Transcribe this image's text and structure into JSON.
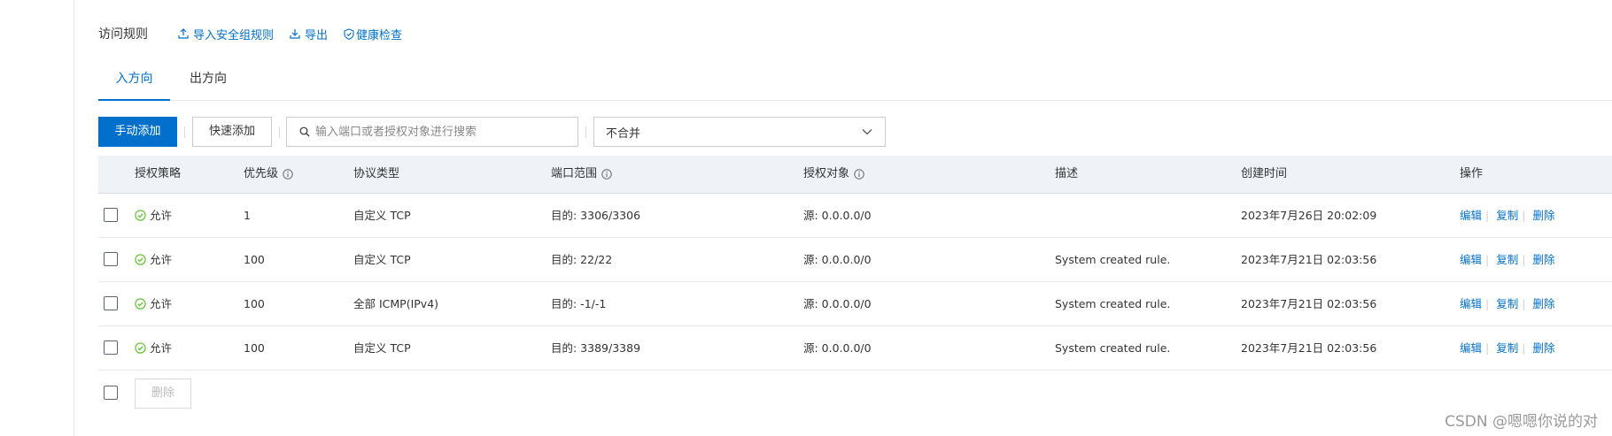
{
  "header": {
    "title": "访问规则",
    "import_label": "导入安全组规则",
    "export_label": "导出",
    "health_label": "健康检查"
  },
  "tabs": [
    {
      "label": "入方向",
      "active": true
    },
    {
      "label": "出方向",
      "active": false
    }
  ],
  "toolbar": {
    "manual_add": "手动添加",
    "quick_add": "快速添加",
    "search_placeholder": "输入端口或者授权对象进行搜索",
    "merge_select_value": "不合并"
  },
  "table": {
    "columns": [
      "授权策略",
      "优先级",
      "协议类型",
      "端口范围",
      "授权对象",
      "描述",
      "创建时间",
      "操作"
    ],
    "rows": [
      {
        "policy": "允许",
        "priority": "1",
        "protocol": "自定义 TCP",
        "port": "目的: 3306/3306",
        "target": "源: 0.0.0.0/0",
        "desc": "",
        "created": "2023年7月26日 20:02:09"
      },
      {
        "policy": "允许",
        "priority": "100",
        "protocol": "自定义 TCP",
        "port": "目的: 22/22",
        "target": "源: 0.0.0.0/0",
        "desc": "System created rule.",
        "created": "2023年7月21日 02:03:56"
      },
      {
        "policy": "允许",
        "priority": "100",
        "protocol": "全部 ICMP(IPv4)",
        "port": "目的: -1/-1",
        "target": "源: 0.0.0.0/0",
        "desc": "System created rule.",
        "created": "2023年7月21日 02:03:56"
      },
      {
        "policy": "允许",
        "priority": "100",
        "protocol": "自定义 TCP",
        "port": "目的: 3389/3389",
        "target": "源: 0.0.0.0/0",
        "desc": "System created rule.",
        "created": "2023年7月21日 02:03:56"
      }
    ],
    "ops": {
      "edit": "编辑",
      "copy": "复制",
      "delete": "删除"
    },
    "footer_delete": "删除"
  },
  "watermark": "CSDN @嗯嗯你说的对",
  "colors": {
    "primary": "#0070cc",
    "allow_green": "#52c41a",
    "header_bg": "#eff3f8"
  }
}
